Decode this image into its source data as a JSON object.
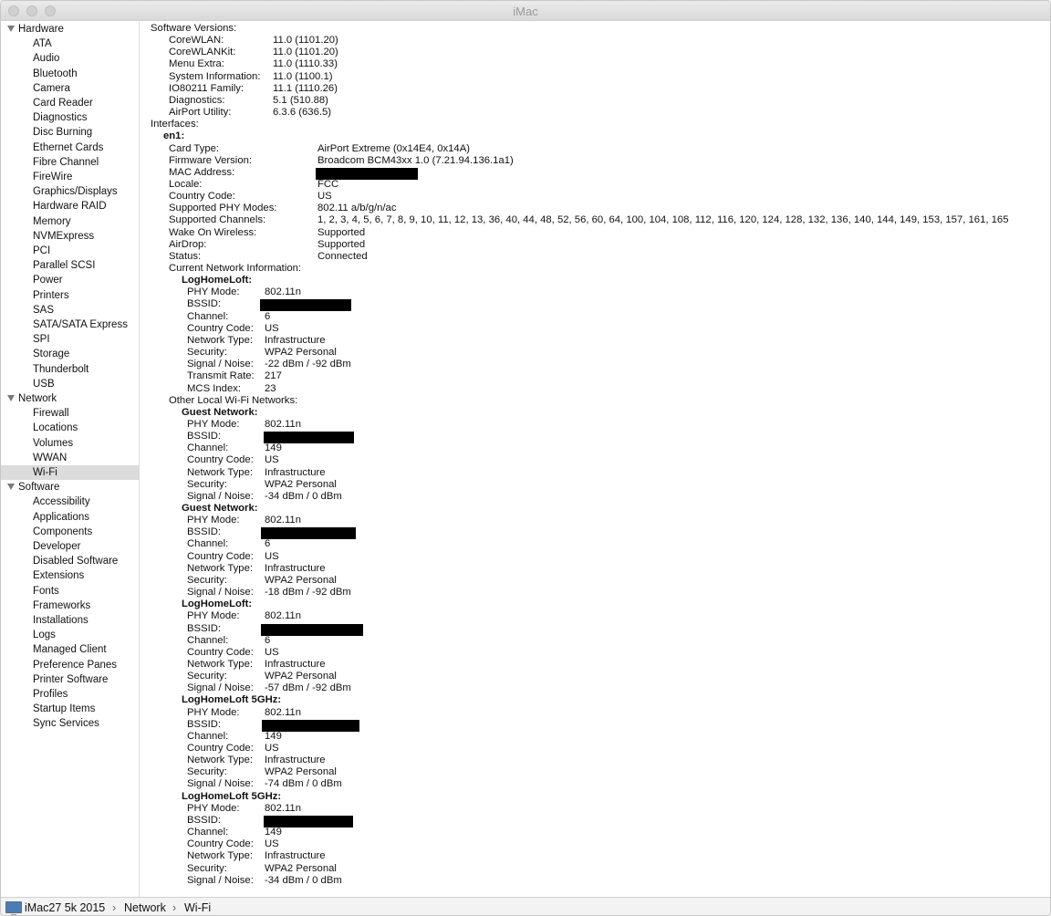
{
  "window": {
    "title": "iMac"
  },
  "sidebar": [
    {
      "label": "Hardware",
      "type": "cat"
    },
    {
      "label": "ATA",
      "type": "item"
    },
    {
      "label": "Audio",
      "type": "item"
    },
    {
      "label": "Bluetooth",
      "type": "item"
    },
    {
      "label": "Camera",
      "type": "item"
    },
    {
      "label": "Card Reader",
      "type": "item"
    },
    {
      "label": "Diagnostics",
      "type": "item"
    },
    {
      "label": "Disc Burning",
      "type": "item"
    },
    {
      "label": "Ethernet Cards",
      "type": "item"
    },
    {
      "label": "Fibre Channel",
      "type": "item"
    },
    {
      "label": "FireWire",
      "type": "item"
    },
    {
      "label": "Graphics/Displays",
      "type": "item"
    },
    {
      "label": "Hardware RAID",
      "type": "item"
    },
    {
      "label": "Memory",
      "type": "item"
    },
    {
      "label": "NVMExpress",
      "type": "item"
    },
    {
      "label": "PCI",
      "type": "item"
    },
    {
      "label": "Parallel SCSI",
      "type": "item"
    },
    {
      "label": "Power",
      "type": "item"
    },
    {
      "label": "Printers",
      "type": "item"
    },
    {
      "label": "SAS",
      "type": "item"
    },
    {
      "label": "SATA/SATA Express",
      "type": "item"
    },
    {
      "label": "SPI",
      "type": "item"
    },
    {
      "label": "Storage",
      "type": "item"
    },
    {
      "label": "Thunderbolt",
      "type": "item"
    },
    {
      "label": "USB",
      "type": "item"
    },
    {
      "label": "Network",
      "type": "cat"
    },
    {
      "label": "Firewall",
      "type": "item"
    },
    {
      "label": "Locations",
      "type": "item"
    },
    {
      "label": "Volumes",
      "type": "item"
    },
    {
      "label": "WWAN",
      "type": "item"
    },
    {
      "label": "Wi-Fi",
      "type": "item",
      "selected": true
    },
    {
      "label": "Software",
      "type": "cat"
    },
    {
      "label": "Accessibility",
      "type": "item"
    },
    {
      "label": "Applications",
      "type": "item"
    },
    {
      "label": "Components",
      "type": "item"
    },
    {
      "label": "Developer",
      "type": "item"
    },
    {
      "label": "Disabled Software",
      "type": "item"
    },
    {
      "label": "Extensions",
      "type": "item"
    },
    {
      "label": "Fonts",
      "type": "item"
    },
    {
      "label": "Frameworks",
      "type": "item"
    },
    {
      "label": "Installations",
      "type": "item"
    },
    {
      "label": "Logs",
      "type": "item"
    },
    {
      "label": "Managed Client",
      "type": "item"
    },
    {
      "label": "Preference Panes",
      "type": "item"
    },
    {
      "label": "Printer Software",
      "type": "item"
    },
    {
      "label": "Profiles",
      "type": "item"
    },
    {
      "label": "Startup Items",
      "type": "item"
    },
    {
      "label": "Sync Services",
      "type": "item"
    }
  ],
  "content": [
    {
      "level": 0,
      "label": "Software Versions:"
    },
    {
      "level": 1,
      "label": "CoreWLAN:",
      "value": "11.0 (1101.20)",
      "col": "a"
    },
    {
      "level": 1,
      "label": "CoreWLANKit:",
      "value": "11.0 (1101.20)",
      "col": "a"
    },
    {
      "level": 1,
      "label": "Menu Extra:",
      "value": "11.0 (1110.33)",
      "col": "a"
    },
    {
      "level": 1,
      "label": "System Information:",
      "value": "11.0 (1100.1)",
      "col": "a"
    },
    {
      "level": 1,
      "label": "IO80211 Family:",
      "value": "11.1 (1110.26)",
      "col": "a"
    },
    {
      "level": 1,
      "label": "Diagnostics:",
      "value": "5.1 (510.88)",
      "col": "a"
    },
    {
      "level": 1,
      "label": "AirPort Utility:",
      "value": "6.3.6 (636.5)",
      "col": "a"
    },
    {
      "level": 0,
      "label": "Interfaces:"
    },
    {
      "level": 0.7,
      "label": "en1:",
      "bold": true
    },
    {
      "level": 1,
      "label": "Card Type:",
      "value": "AirPort Extreme  (0x14E4, 0x14A)",
      "col": "b"
    },
    {
      "level": 1,
      "label": "Firmware Version:",
      "value": "Broadcom BCM43xx 1.0 (7.21.94.136.1a1)",
      "col": "b"
    },
    {
      "level": 1,
      "label": "MAC Address:",
      "redacted": 112,
      "col": "b"
    },
    {
      "level": 1,
      "label": "Locale:",
      "value": "FCC",
      "col": "b"
    },
    {
      "level": 1,
      "label": "Country Code:",
      "value": "US",
      "col": "b"
    },
    {
      "level": 1,
      "label": "Supported PHY Modes:",
      "value": "802.11 a/b/g/n/ac",
      "col": "b"
    },
    {
      "level": 1,
      "label": "Supported Channels:",
      "value": "1, 2, 3, 4, 5, 6, 7, 8, 9, 10, 11, 12, 13, 36, 40, 44, 48, 52, 56, 60, 64, 100, 104, 108, 112, 116, 120, 124, 128, 132, 136, 140, 144, 149, 153, 157, 161, 165",
      "col": "b"
    },
    {
      "level": 1,
      "label": "Wake On Wireless:",
      "value": "Supported",
      "col": "b"
    },
    {
      "level": 1,
      "label": "AirDrop:",
      "value": "Supported",
      "col": "b"
    },
    {
      "level": 1,
      "label": "Status:",
      "value": "Connected",
      "col": "b"
    },
    {
      "level": 1,
      "label": "Current Network Information:"
    },
    {
      "level": 1.7,
      "label": "LogHomeLoft:",
      "bold": true
    },
    {
      "level": 2,
      "label": "PHY Mode:",
      "value": "802.11n",
      "col": "c"
    },
    {
      "level": 2,
      "label": "BSSID:",
      "redacted": 100,
      "col": "c",
      "rx": -5
    },
    {
      "level": 2,
      "label": "Channel:",
      "value": "6",
      "col": "c"
    },
    {
      "level": 2,
      "label": "Country Code:",
      "value": "US",
      "col": "c"
    },
    {
      "level": 2,
      "label": "Network Type:",
      "value": "Infrastructure",
      "col": "c"
    },
    {
      "level": 2,
      "label": "Security:",
      "value": "WPA2 Personal",
      "col": "c"
    },
    {
      "level": 2,
      "label": "Signal / Noise:",
      "value": "-22 dBm / -92 dBm",
      "col": "c"
    },
    {
      "level": 2,
      "label": "Transmit Rate:",
      "value": "217",
      "col": "c"
    },
    {
      "level": 2,
      "label": "MCS Index:",
      "value": "23",
      "col": "c"
    },
    {
      "level": 1,
      "label": "Other Local Wi-Fi Networks:"
    },
    {
      "level": 1.7,
      "label": "Guest Network:",
      "bold": true
    },
    {
      "level": 2,
      "label": "PHY Mode:",
      "value": "802.11n",
      "col": "c"
    },
    {
      "level": 2,
      "label": "BSSID:",
      "redacted": 99,
      "col": "c",
      "rx": -1
    },
    {
      "level": 2,
      "label": "Channel:",
      "value": "149",
      "col": "c"
    },
    {
      "level": 2,
      "label": "Country Code:",
      "value": "US",
      "col": "c"
    },
    {
      "level": 2,
      "label": "Network Type:",
      "value": "Infrastructure",
      "col": "c"
    },
    {
      "level": 2,
      "label": "Security:",
      "value": "WPA2 Personal",
      "col": "c"
    },
    {
      "level": 2,
      "label": "Signal / Noise:",
      "value": "-34 dBm / 0 dBm",
      "col": "c"
    },
    {
      "level": 1.7,
      "label": "Guest Network:",
      "bold": true
    },
    {
      "level": 2,
      "label": "PHY Mode:",
      "value": "802.11n",
      "col": "c"
    },
    {
      "level": 2,
      "label": "BSSID:",
      "redacted": 104,
      "col": "c",
      "rx": -4
    },
    {
      "level": 2,
      "label": "Channel:",
      "value": "6",
      "col": "c"
    },
    {
      "level": 2,
      "label": "Country Code:",
      "value": "US",
      "col": "c"
    },
    {
      "level": 2,
      "label": "Network Type:",
      "value": "Infrastructure",
      "col": "c"
    },
    {
      "level": 2,
      "label": "Security:",
      "value": "WPA2 Personal",
      "col": "c"
    },
    {
      "level": 2,
      "label": "Signal / Noise:",
      "value": "-18 dBm / -92 dBm",
      "col": "c"
    },
    {
      "level": 1.7,
      "label": "LogHomeLoft:",
      "bold": true
    },
    {
      "level": 2,
      "label": "PHY Mode:",
      "value": "802.11n",
      "col": "c"
    },
    {
      "level": 2,
      "label": "BSSID:",
      "redacted": 112,
      "col": "c",
      "rx": -4
    },
    {
      "level": 2,
      "label": "Channel:",
      "value": "6",
      "col": "c"
    },
    {
      "level": 2,
      "label": "Country Code:",
      "value": "US",
      "col": "c"
    },
    {
      "level": 2,
      "label": "Network Type:",
      "value": "Infrastructure",
      "col": "c"
    },
    {
      "level": 2,
      "label": "Security:",
      "value": "WPA2 Personal",
      "col": "c"
    },
    {
      "level": 2,
      "label": "Signal / Noise:",
      "value": "-57 dBm / -92 dBm",
      "col": "c"
    },
    {
      "level": 1.7,
      "label": "LogHomeLoft 5GHz:",
      "bold": true
    },
    {
      "level": 2,
      "label": "PHY Mode:",
      "value": "802.11n",
      "col": "c"
    },
    {
      "level": 2,
      "label": "BSSID:",
      "redacted": 107,
      "col": "c",
      "rx": -3
    },
    {
      "level": 2,
      "label": "Channel:",
      "value": "149",
      "col": "c"
    },
    {
      "level": 2,
      "label": "Country Code:",
      "value": "US",
      "col": "c"
    },
    {
      "level": 2,
      "label": "Network Type:",
      "value": "Infrastructure",
      "col": "c"
    },
    {
      "level": 2,
      "label": "Security:",
      "value": "WPA2 Personal",
      "col": "c"
    },
    {
      "level": 2,
      "label": "Signal / Noise:",
      "value": "-74 dBm / 0 dBm",
      "col": "c"
    },
    {
      "level": 1.7,
      "label": "LogHomeLoft 5GHz:",
      "bold": true
    },
    {
      "level": 2,
      "label": "PHY Mode:",
      "value": "802.11n",
      "col": "c"
    },
    {
      "level": 2,
      "label": "BSSID:",
      "redacted": 98,
      "col": "c",
      "rx": -1
    },
    {
      "level": 2,
      "label": "Channel:",
      "value": "149",
      "col": "c"
    },
    {
      "level": 2,
      "label": "Country Code:",
      "value": "US",
      "col": "c"
    },
    {
      "level": 2,
      "label": "Network Type:",
      "value": "Infrastructure",
      "col": "c"
    },
    {
      "level": 2,
      "label": "Security:",
      "value": "WPA2 Personal",
      "col": "c"
    },
    {
      "level": 2,
      "label": "Signal / Noise:",
      "value": "-34 dBm / 0 dBm",
      "col": "c"
    }
  ],
  "pathbar": {
    "crumbs": [
      "iMac27 5k 2015",
      "Network",
      "Wi-Fi"
    ],
    "separator": "›"
  }
}
